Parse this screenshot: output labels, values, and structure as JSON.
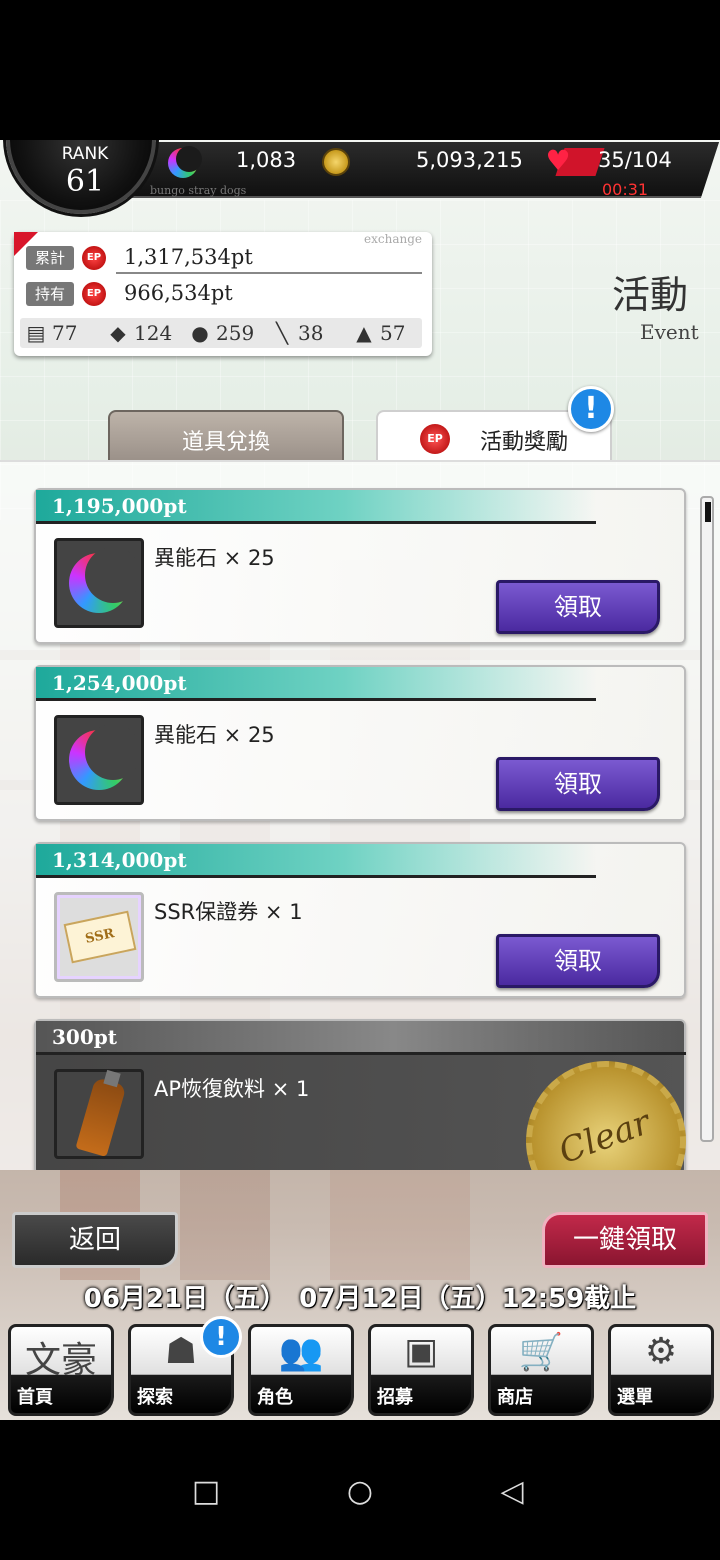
{
  "top": {
    "rank_label": "RANK",
    "rank_value": "61",
    "subtitle": "bungo stray dogs",
    "gems": "1,083",
    "coins": "5,093,215",
    "ap": "35/104",
    "ap_timer": "00:31"
  },
  "ep": {
    "exchange_tag": "exchange",
    "total_label": "累計",
    "total_value": "1,317,534pt",
    "owned_label": "持有",
    "owned_value": "966,534pt",
    "ep_icon": "EP",
    "items": [
      {
        "icon": "card-icon",
        "count": "77"
      },
      {
        "icon": "shoe-icon",
        "count": "124"
      },
      {
        "icon": "candy-icon",
        "count": "259"
      },
      {
        "icon": "tie-icon",
        "count": "38"
      },
      {
        "icon": "shirt-icon",
        "count": "57"
      }
    ]
  },
  "page": {
    "title": "活動",
    "subtitle": "Event"
  },
  "tabs": {
    "exchange": "道具兌換",
    "reward": "活動獎勵",
    "ep_icon": "EP",
    "notice": "!"
  },
  "rewards": [
    {
      "points": "1,195,000pt",
      "item": "異能石 × 25",
      "button": "領取",
      "status": "claimable"
    },
    {
      "points": "1,254,000pt",
      "item": "異能石 × 25",
      "button": "領取",
      "status": "claimable"
    },
    {
      "points": "1,314,000pt",
      "item": "SSR保證券 × 1",
      "button": "領取",
      "status": "claimable"
    },
    {
      "points": "300pt",
      "item": "AP恢復飲料 × 1",
      "stamp": "Clear",
      "status": "cleared"
    }
  ],
  "ticket_text": "SSR",
  "bottom": {
    "back": "返回",
    "claim_all": "一鍵領取",
    "period": "06月21日（五）　07月12日（五）12:59截止"
  },
  "nav": [
    {
      "label": "首頁",
      "glyph": "文豪",
      "icon": "home-icon"
    },
    {
      "label": "探索",
      "glyph": "☗",
      "icon": "explore-icon"
    },
    {
      "label": "角色",
      "glyph": "👥",
      "icon": "character-icon"
    },
    {
      "label": "招募",
      "glyph": "▣",
      "icon": "recruit-icon"
    },
    {
      "label": "商店",
      "glyph": "🛒",
      "icon": "shop-icon"
    },
    {
      "label": "選單",
      "glyph": "⚙",
      "icon": "menu-icon"
    }
  ],
  "nav_badge": "!",
  "colors": {
    "accent_teal": "#1ea99b",
    "claim_purple": "#5a3ab8",
    "claim_all_red": "#a81c3c"
  }
}
